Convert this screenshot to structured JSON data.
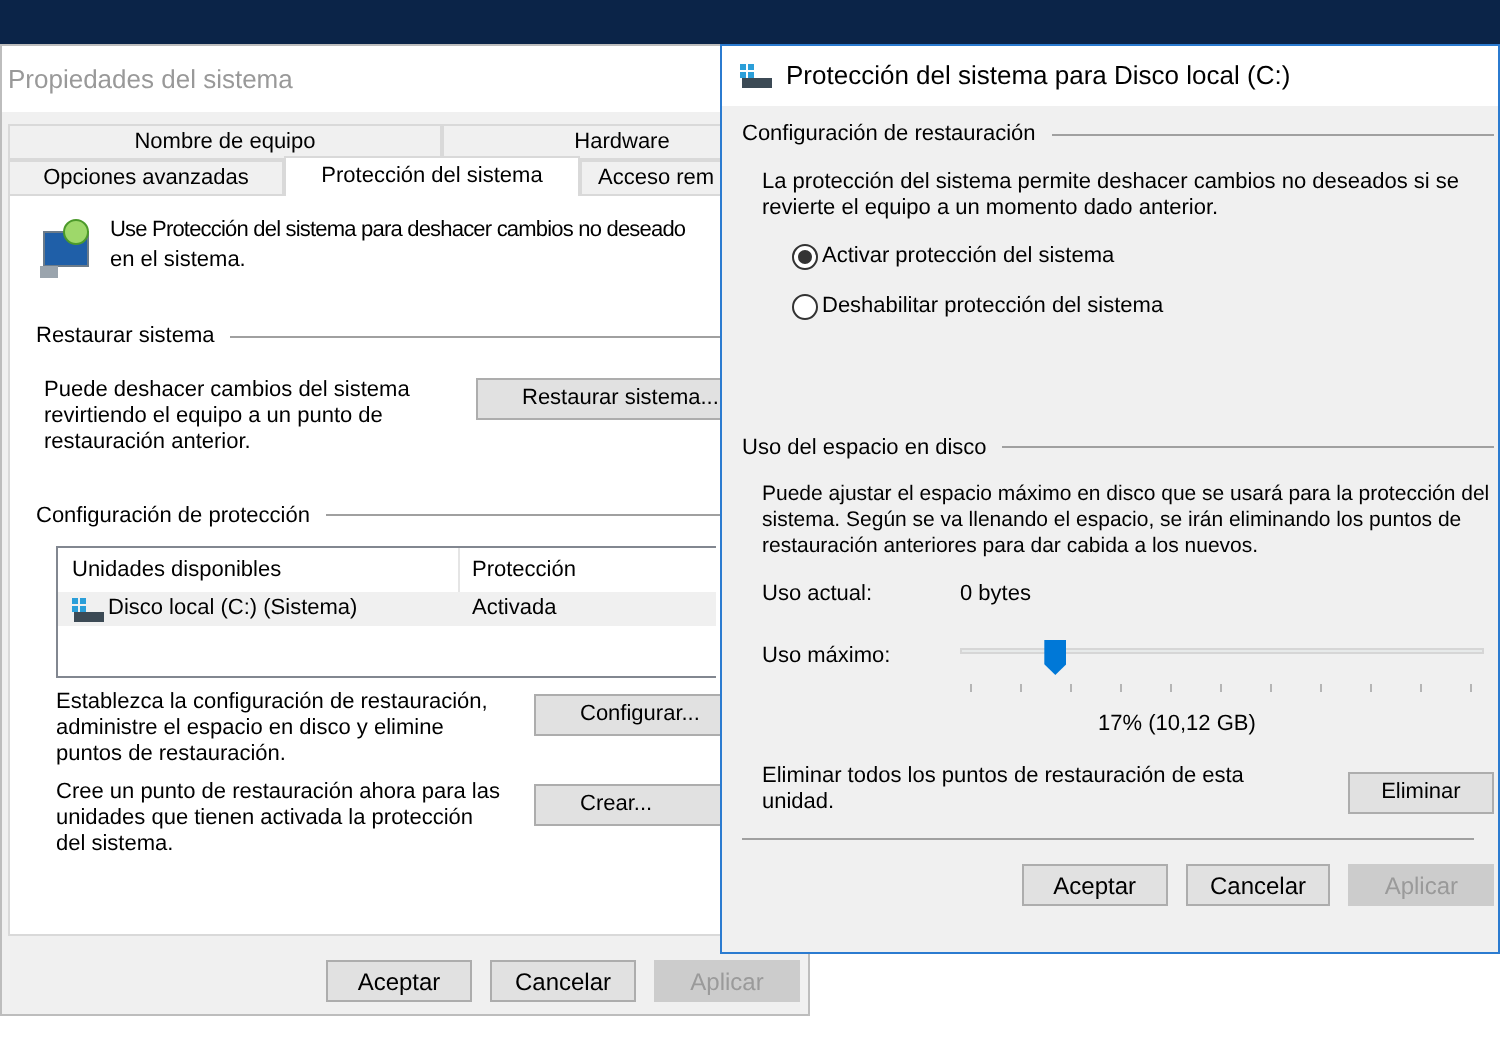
{
  "back_window": {
    "title": "Propiedades del sistema",
    "tab_rows": [
      [
        {
          "label": "Nombre de equipo",
          "selected": false
        },
        {
          "label": "Hardware",
          "selected": false
        }
      ],
      [
        {
          "label": "Opciones avanzadas",
          "selected": false
        },
        {
          "label": "Protección del sistema",
          "selected": true
        },
        {
          "label": "Acceso rem",
          "selected": false
        }
      ]
    ],
    "intro": "Use Protección del sistema para deshacer cambios no deseado",
    "intro_line2": "en el sistema.",
    "restore_section": {
      "heading": "Restaurar sistema",
      "text": "Puede deshacer cambios del sistema revirtiendo el equipo a un punto de restauración anterior.",
      "button": "Restaurar sistema..."
    },
    "protection_section": {
      "heading": "Configuración de protección",
      "columns": [
        "Unidades disponibles",
        "Protección"
      ],
      "rows": [
        {
          "drive": "Disco local (C:) (Sistema)",
          "protection": "Activada",
          "selected": true
        }
      ],
      "actions": [
        {
          "text": "Establezca la configuración de restauración, administre el espacio en disco y elimine puntos de restauración.",
          "button": "Configurar..."
        },
        {
          "text": "Cree un punto de restauración ahora para las unidades que tienen activada la protección del sistema.",
          "button": "Crear..."
        }
      ]
    },
    "buttons": [
      {
        "label": "Aceptar",
        "disabled": false
      },
      {
        "label": "Cancelar",
        "disabled": false
      },
      {
        "label": "Aplicar",
        "disabled": true
      }
    ]
  },
  "dialog": {
    "title": "Protección del sistema para Disco local (C:)",
    "restore_settings": {
      "heading": "Configuración de restauración",
      "text": "La protección del sistema permite deshacer cambios no deseados si se revierte el equipo a un momento dado anterior.",
      "options": [
        {
          "label": "Activar protección del sistema",
          "selected": true
        },
        {
          "label": "Deshabilitar protección del sistema",
          "selected": false
        }
      ]
    },
    "disk_usage": {
      "heading": "Uso del espacio en disco",
      "text": "Puede ajustar el espacio máximo en disco que se usará para la protección del sistema. Según se va llenando el espacio, se irán eliminando los puntos de restauración anteriores para dar cabida a los nuevos.",
      "current_label": "Uso actual:",
      "current_value": "0 bytes",
      "max_label": "Uso máximo:",
      "level": 0.18,
      "reading": "17% (10,12 GB)",
      "delete_text": "Eliminar todos los puntos de restauración de esta unidad.",
      "delete_button": "Eliminar"
    },
    "buttons": [
      {
        "label": "Aceptar",
        "disabled": false
      },
      {
        "label": "Cancelar",
        "disabled": false
      },
      {
        "label": "Aplicar",
        "disabled": true
      }
    ]
  }
}
